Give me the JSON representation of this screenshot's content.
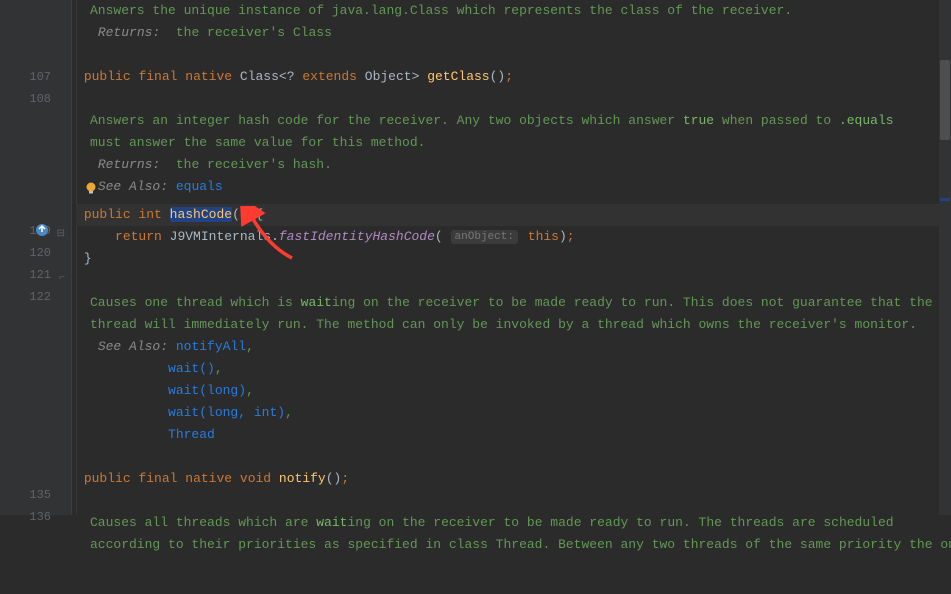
{
  "gutter": {
    "lines": [
      "",
      "",
      "",
      "107",
      "108",
      "",
      "",
      "",
      "",
      "",
      "119",
      "120",
      "121",
      "122",
      "",
      "",
      "",
      "",
      "",
      "",
      "",
      "",
      "135",
      "136",
      "",
      "",
      ""
    ]
  },
  "doc1": {
    "l1": "Answers the unique instance of java.lang.Class which represents the class of the receiver.",
    "returns_label": "Returns:",
    "returns_val": "the receiver's Class"
  },
  "code107": {
    "kw_public": "public",
    "kw_final": "final",
    "kw_native": "native",
    "type_class": "Class",
    "lt": "<",
    "q": "?",
    "kw_extends": "extends",
    "type_obj": "Object",
    "gt": ">",
    "method": "getClass",
    "parens": "()",
    "semi": ";"
  },
  "doc2": {
    "l1a": "Answers an integer hash code for the receiver. Any two objects which answer ",
    "l1b": "true",
    "l1c": " when passed to ",
    "l1d": ".equals",
    "l2": "must answer the same value for this method.",
    "returns_label": "Returns:",
    "returns_val": "the receiver's hash.",
    "see_label": "See Also:",
    "see_val": "equals"
  },
  "code119": {
    "kw_public": "public",
    "kw_int": "int",
    "method": "hashCode",
    "parens": "()",
    "brace": "{"
  },
  "code120": {
    "kw_return": "return",
    "cls": "J9VMInternals",
    "dot": ".",
    "call": "fastIdentityHashCode",
    "lp": "(",
    "hint": "anObject:",
    "kw_this": "this",
    "rp": ")",
    "semi": ";"
  },
  "code121": {
    "brace": "}"
  },
  "doc3": {
    "l1a": "Causes one thread which is ",
    "l1b": "wait",
    "l1c": "ing on the receiver to be made ready to run. This does not guarantee that the",
    "l2": "thread will immediately run. The method can only be invoked by a thread which owns the receiver's monitor.",
    "see_label": "See Also:",
    "s1": "notifyAll",
    "s2": "wait()",
    "s3a": "wait(",
    "s3b": "long",
    "s3c": ")",
    "s4a": "wait(",
    "s4b": "long, int",
    "s4c": ")",
    "s5": "Thread"
  },
  "code135": {
    "kw_public": "public",
    "kw_final": "final",
    "kw_native": "native",
    "kw_void": "void",
    "method": "notify",
    "parens": "()",
    "semi": ";"
  },
  "doc4": {
    "l1a": "Causes all threads which are ",
    "l1b": "wait",
    "l1c": "ing on the receiver to be made ready to run. The threads are scheduled",
    "l2": "according to their priorities as specified in class Thread. Between any two threads of the same priority the one"
  },
  "colors": {
    "arrow": "#ff3b30",
    "bulb_fill": "#f0a732"
  }
}
